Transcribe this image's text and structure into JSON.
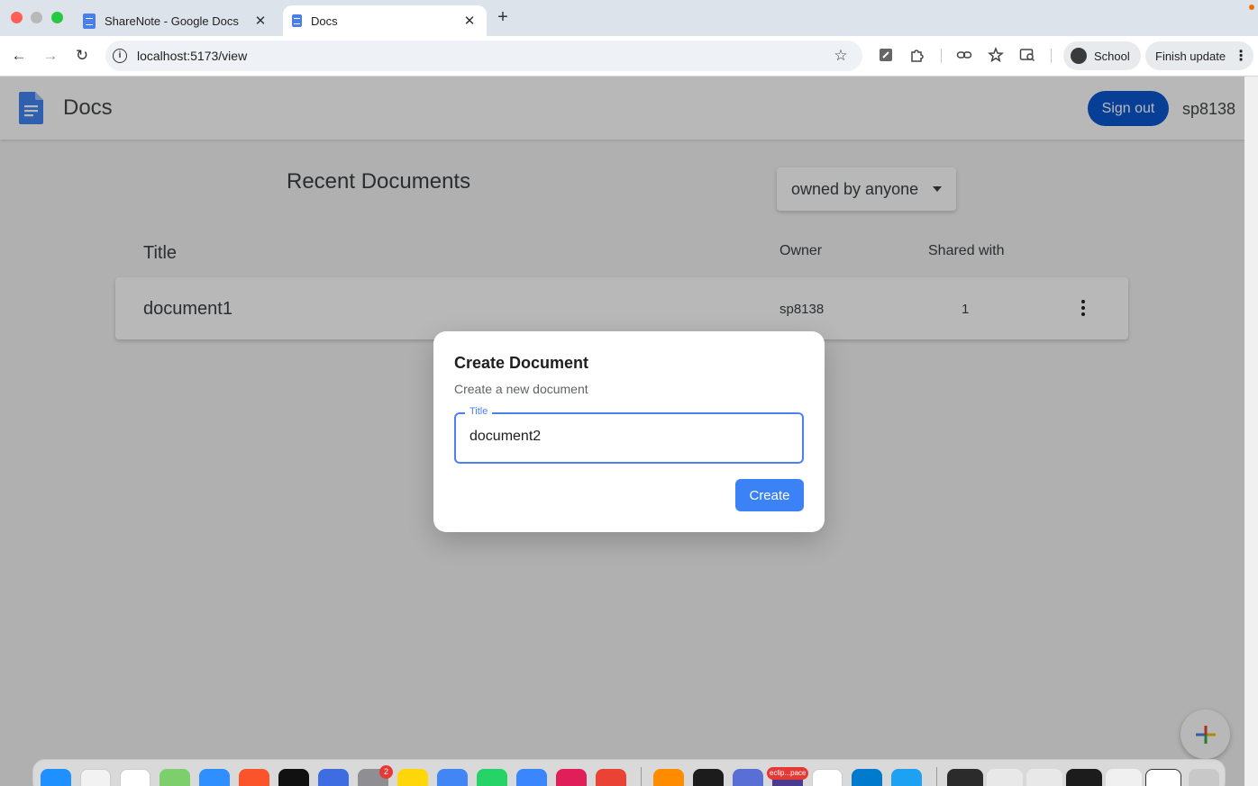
{
  "browser": {
    "tabs": [
      {
        "title": "ShareNote - Google Docs",
        "close": "✕",
        "active": false
      },
      {
        "title": "Docs",
        "close": "✕",
        "active": true
      }
    ],
    "new_tab": "+",
    "url": "localhost:5173/view",
    "profile_label": "School",
    "update_label": "Finish update"
  },
  "app": {
    "title": "Docs",
    "signout_label": "Sign out",
    "username": "sp8138",
    "accent": "#0b57d0"
  },
  "documents": {
    "heading": "Recent Documents",
    "filter_value": "owned by anyone",
    "columns": {
      "title": "Title",
      "owner": "Owner",
      "shared": "Shared with"
    },
    "rows": [
      {
        "title": "document1",
        "owner": "sp8138",
        "shared": "1"
      }
    ]
  },
  "modal": {
    "title": "Create Document",
    "subtitle": "Create a new document",
    "field_label": "Title",
    "field_value": "document2",
    "create_label": "Create"
  },
  "dock": {
    "settings_badge": "2",
    "eclipse_label": "eclip...pace"
  }
}
